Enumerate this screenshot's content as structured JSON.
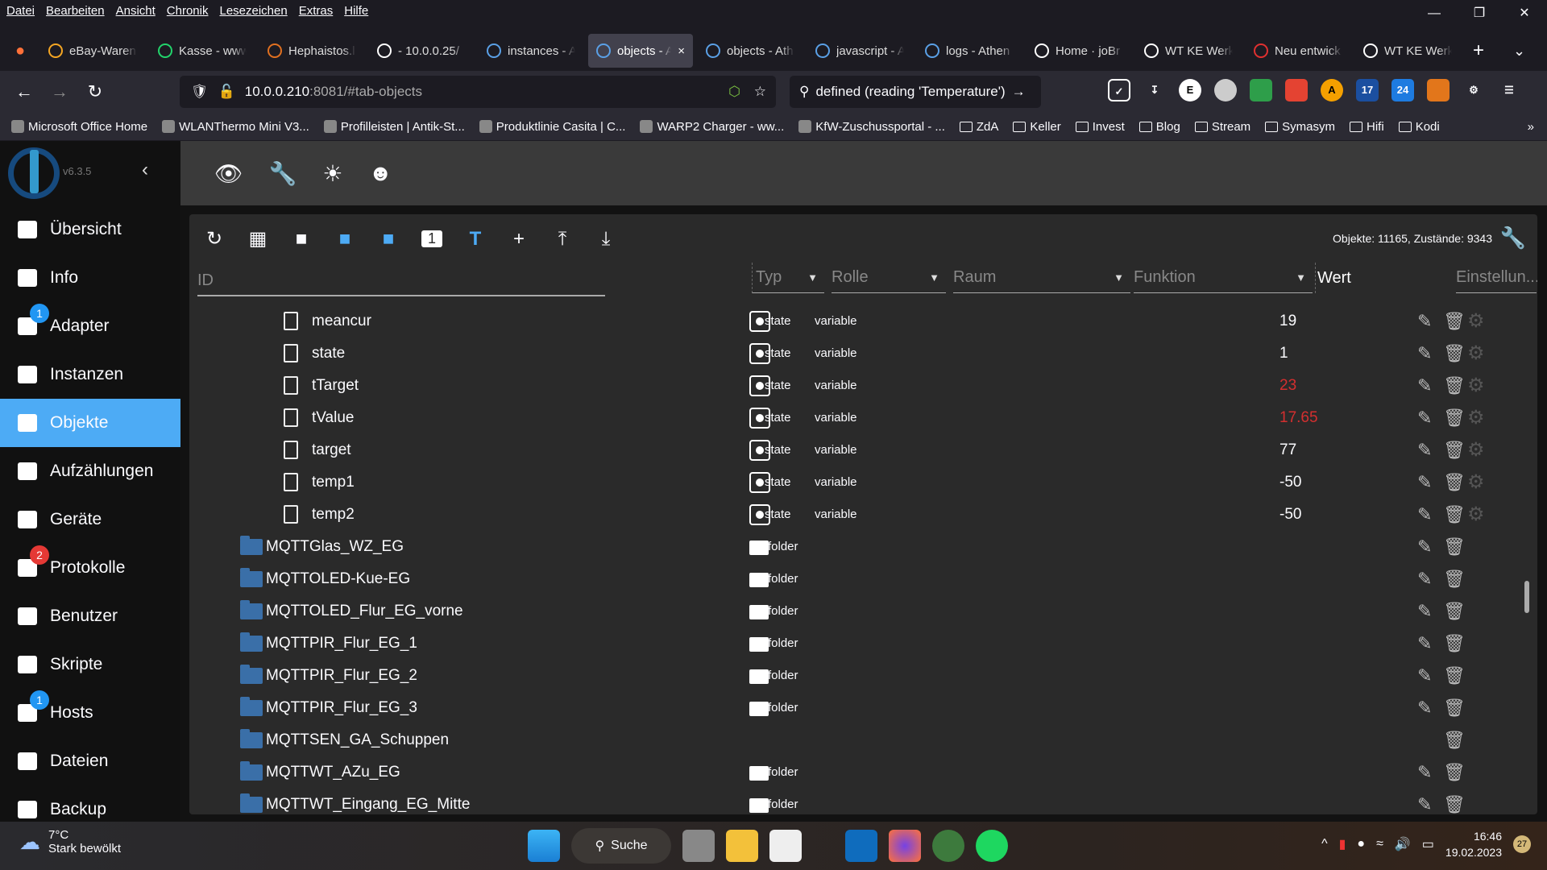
{
  "menu": [
    "Datei",
    "Bearbeiten",
    "Ansicht",
    "Chronik",
    "Lesezeichen",
    "Extras",
    "Hilfe"
  ],
  "tabs": [
    {
      "title": "eBay-Warenkorb",
      "color": "#f5a623"
    },
    {
      "title": "Kasse - www",
      "color": "#22d36b"
    },
    {
      "title": "Hephaistos.l",
      "color": "#e07020"
    },
    {
      "title": "- 10.0.0.25/",
      "color": "#ffffff"
    },
    {
      "title": "instances - A",
      "color": "#5aa0e6"
    },
    {
      "title": "objects - A",
      "color": "#5aa0e6",
      "active": true
    },
    {
      "title": "objects - Ath",
      "color": "#5aa0e6"
    },
    {
      "title": "javascript - A",
      "color": "#5aa0e6"
    },
    {
      "title": "logs - Athen",
      "color": "#5aa0e6"
    },
    {
      "title": "Home · joBr",
      "color": "#ffffff"
    },
    {
      "title": "WT KE Werk",
      "color": "#ffffff"
    },
    {
      "title": "Neu entwick",
      "color": "#e03030"
    },
    {
      "title": "WT KE Werk",
      "color": "#ffffff"
    }
  ],
  "url": {
    "host": "10.0.0.210",
    "rest": ":8081/#tab-objects"
  },
  "search": "defined (reading 'Temperature')",
  "bookmarks": [
    "Microsoft Office Home",
    "WLANThermo Mini V3...",
    "Profilleisten | Antik-St...",
    "Produktlinie Casita | C...",
    "WARP2 Charger - ww...",
    "KfW-Zuschussportal - ...",
    "ZdA",
    "Keller",
    "Invest",
    "Blog",
    "Stream",
    "Symasym",
    "Hifi",
    "Kodi"
  ],
  "app": {
    "version": "v6.3.5",
    "accent": "#4dabf5"
  },
  "sidebar": [
    {
      "label": "Übersicht",
      "icon": "grid-icon"
    },
    {
      "label": "Info",
      "icon": "info-icon"
    },
    {
      "label": "Adapter",
      "icon": "store-icon",
      "badge": "1",
      "badge_color": "#2196f3"
    },
    {
      "label": "Instanzen",
      "icon": "instances-icon"
    },
    {
      "label": "Objekte",
      "icon": "list-icon",
      "active": true
    },
    {
      "label": "Aufzählungen",
      "icon": "enum-icon"
    },
    {
      "label": "Geräte",
      "icon": "devices-icon"
    },
    {
      "label": "Protokolle",
      "icon": "log-icon",
      "badge": "2",
      "badge_color": "#e53935"
    },
    {
      "label": "Benutzer",
      "icon": "user-icon"
    },
    {
      "label": "Skripte",
      "icon": "js-icon"
    },
    {
      "label": "Hosts",
      "icon": "hosts-icon",
      "badge": "1",
      "badge_color": "#2196f3"
    },
    {
      "label": "Dateien",
      "icon": "files-icon"
    },
    {
      "label": "Backup",
      "icon": "backup-icon"
    }
  ],
  "counts": "Objekte: 11165, Zustände: 9343",
  "columns": {
    "id": "ID",
    "type": "Typ",
    "role": "Rolle",
    "room": "Raum",
    "func": "Funktion",
    "value": "Wert",
    "settings": "Einstellun..."
  },
  "rows": [
    {
      "name": "meancur",
      "kind": "state",
      "type": "state",
      "role": "variable",
      "value": "19"
    },
    {
      "name": "state",
      "kind": "state",
      "type": "state",
      "role": "variable",
      "value": "1"
    },
    {
      "name": "tTarget",
      "kind": "state",
      "type": "state",
      "role": "variable",
      "value": "23",
      "value_color": "#d32f2f"
    },
    {
      "name": "tValue",
      "kind": "state",
      "type": "state",
      "role": "variable",
      "value": "17.65",
      "value_color": "#d32f2f"
    },
    {
      "name": "target",
      "kind": "state",
      "type": "state",
      "role": "variable",
      "value": "77"
    },
    {
      "name": "temp1",
      "kind": "state",
      "type": "state",
      "role": "variable",
      "value": "-50"
    },
    {
      "name": "temp2",
      "kind": "state",
      "type": "state",
      "role": "variable",
      "value": "-50"
    },
    {
      "name": "MQTTGlas_WZ_EG",
      "kind": "folder",
      "type": "folder"
    },
    {
      "name": "MQTTOLED-Kue-EG",
      "kind": "folder",
      "type": "folder"
    },
    {
      "name": "MQTTOLED_Flur_EG_vorne",
      "kind": "folder",
      "type": "folder"
    },
    {
      "name": "MQTTPIR_Flur_EG_1",
      "kind": "folder",
      "type": "folder"
    },
    {
      "name": "MQTTPIR_Flur_EG_2",
      "kind": "folder",
      "type": "folder"
    },
    {
      "name": "MQTTPIR_Flur_EG_3",
      "kind": "folder",
      "type": "folder"
    },
    {
      "name": "MQTTSEN_GA_Schuppen",
      "kind": "folder",
      "type": "",
      "noedit": true
    },
    {
      "name": "MQTTWT_AZu_EG",
      "kind": "folder",
      "type": "folder"
    },
    {
      "name": "MQTTWT_Eingang_EG_Mitte",
      "kind": "folder",
      "type": "folder"
    }
  ],
  "taskbar": {
    "temp": "7°C",
    "weather": "Stark bewölkt",
    "search": "Suche",
    "time": "16:46",
    "date": "19.02.2023",
    "notif": "27"
  }
}
